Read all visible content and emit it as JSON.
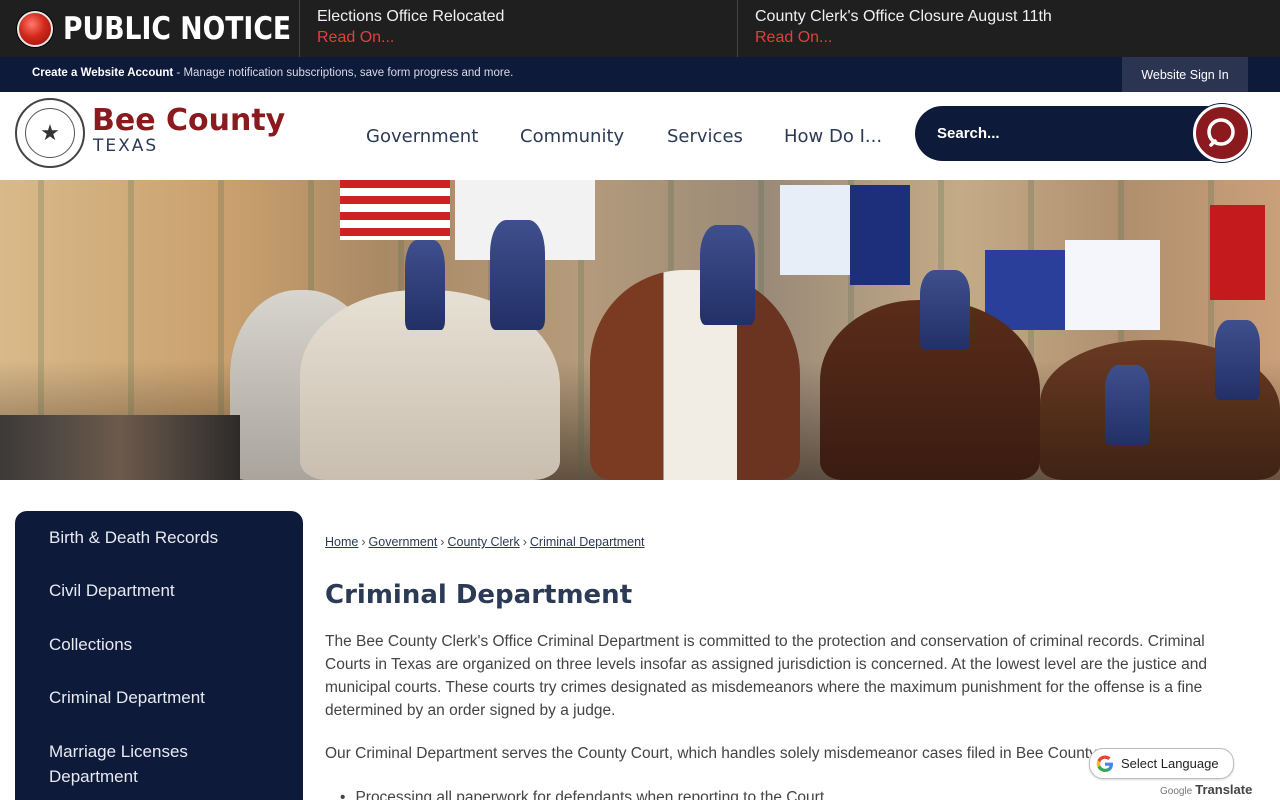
{
  "notice": {
    "label": "PUBLIC NOTICE",
    "items": [
      {
        "title": "Elections Office Relocated",
        "link": "Read On..."
      },
      {
        "title": "County Clerk's Office Closure August 11th",
        "link": "Read On..."
      }
    ]
  },
  "account": {
    "create_label": "Create a Website Account",
    "create_desc": " - Manage notification subscriptions, save form progress and more.",
    "signin": "Website Sign In"
  },
  "logo": {
    "title": "Bee County",
    "subtitle": "TEXAS",
    "seal_glyph": "★"
  },
  "nav": {
    "government": "Government",
    "community": "Community",
    "services": "Services",
    "how": "How Do I..."
  },
  "search": {
    "placeholder": "Search..."
  },
  "sidebar": {
    "items": [
      "Birth & Death Records",
      "Civil Department",
      "Collections",
      "Criminal Department",
      "Marriage Licenses Department"
    ]
  },
  "breadcrumb": {
    "items": [
      "Home",
      "Government",
      "County Clerk",
      "Criminal Department"
    ],
    "separator": "›"
  },
  "page": {
    "title": "Criminal Department",
    "para1": "The Bee County Clerk's Office Criminal Department is committed to the protection and conservation of criminal records. Criminal Courts in Texas are organized on three levels insofar as assigned jurisdiction is concerned. At the lowest level are the justice and municipal courts. These courts try crimes designated as misdemeanors where the maximum punishment for the offense is a fine determined by an order signed by a judge.",
    "para2": "Our Criminal Department serves the County Court, which handles solely misdemeanor cases filed in Bee County",
    "bullet1": "Processing all paperwork for defendants when reporting to the Court"
  },
  "translate": {
    "label": "Select Language",
    "credit_google": "Google",
    "credit_translate": "Translate"
  },
  "colors": {
    "navy": "#0d1a3a",
    "maroon": "#8b1a1f",
    "notice_red": "#e0413a"
  }
}
